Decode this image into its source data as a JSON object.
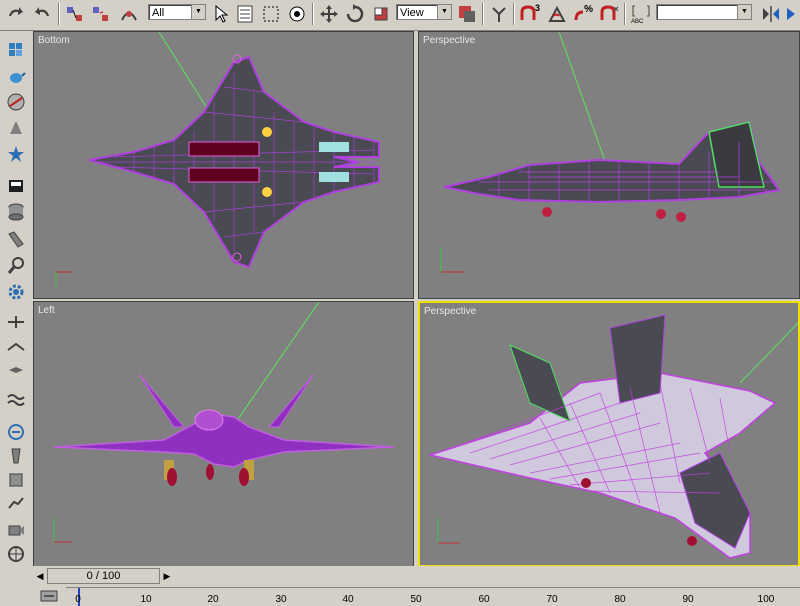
{
  "toolbar": {
    "selection_filter": "All",
    "reference_coord": "View",
    "named_selection": "",
    "buttons": [
      "undo-icon",
      "redo-icon",
      "select-and-link-icon",
      "unlink-icon",
      "bind-space-warp-icon",
      "select-object-icon",
      "select-by-name-icon",
      "region-select-icon",
      "window-crossing-icon",
      "move-icon",
      "rotate-icon",
      "scale-icon",
      "pivot-icon",
      "snap-3d-icon",
      "angle-snap-icon",
      "percent-snap-icon",
      "spinner-snap-icon",
      "edit-named-selection-icon",
      "mirror-icon",
      "align-icon"
    ],
    "snap_labels": {
      "snap3": "3",
      "percent": "%"
    },
    "edit_named_label": "ABC"
  },
  "sidebar": {
    "items": [
      "create-box-icon",
      "teapot-icon",
      "sphere-icon",
      "star-icon",
      "lights-icon",
      "cylinder-icon",
      "tube-icon",
      "magnifier-icon",
      "gear-icon",
      "helper-icon",
      "space-warp-icon",
      "wave-icon",
      "link-icon",
      "bone-icon",
      "display-icon",
      "utility-icon",
      "character-icon",
      "camera-icon",
      "wheel-icon",
      "system-icon"
    ]
  },
  "viewports": [
    {
      "label": "Bottom",
      "active": false
    },
    {
      "label": "Perspective",
      "active": false
    },
    {
      "label": "Left",
      "active": false
    },
    {
      "label": "Perspective",
      "active": true
    }
  ],
  "timeline": {
    "frame_display": "0 / 100",
    "ruler_labels": [
      "0",
      "10",
      "20",
      "30",
      "40",
      "50",
      "60",
      "70",
      "80",
      "90",
      "100"
    ]
  },
  "colors": {
    "wire": "#b040e0",
    "panel": "#4a4a52",
    "viewport_bg": "#808080",
    "active_border": "#f0e000"
  }
}
